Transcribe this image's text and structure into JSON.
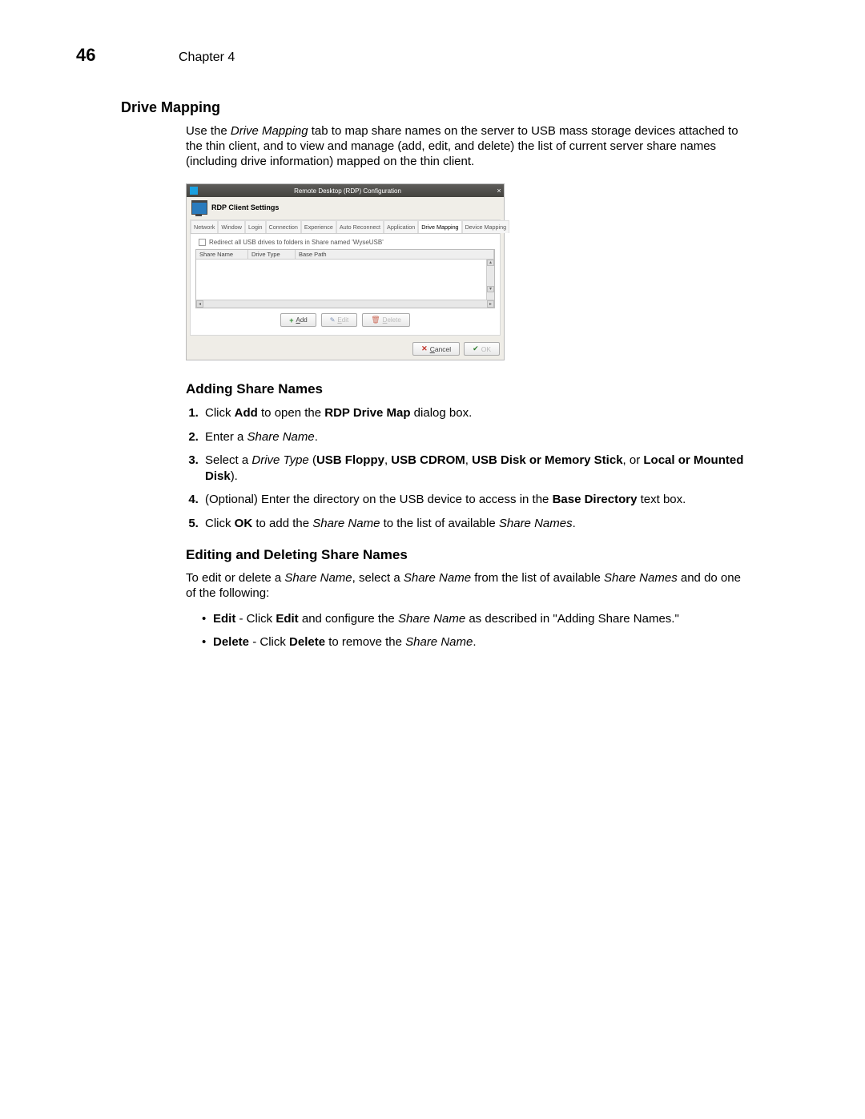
{
  "header": {
    "page_number": "46",
    "chapter": "Chapter 4"
  },
  "s1": {
    "title": "Drive Mapping",
    "para1_a": "Use the ",
    "para1_b": "Drive Mapping",
    "para1_c": " tab to map share names on the server to USB mass storage devices attached to the thin client, and to view and manage (add, edit, and delete) the list of current server share names (including drive information) mapped on the thin client."
  },
  "dlg": {
    "title": "Remote Desktop (RDP) Configuration",
    "subtitle": "RDP Client Settings",
    "tabs": [
      "Network",
      "Window",
      "Login",
      "Connection",
      "Experience",
      "Auto Reconnect",
      "Application",
      "Drive Mapping",
      "Device Mapping"
    ],
    "active_tab": "Drive Mapping",
    "checkbox": "Redirect all USB drives to folders in Share named 'WyseUSB'",
    "cols": [
      "Share Name",
      "Drive Type",
      "Base Path"
    ],
    "btn_add": "Add",
    "btn_edit": "Edit",
    "btn_delete": "Delete",
    "btn_cancel": "Cancel",
    "btn_ok": "OK"
  },
  "s2": {
    "title": "Adding Share Names",
    "i1a": "Click ",
    "i1b": "Add",
    "i1c": " to open the ",
    "i1d": "RDP Drive Map",
    "i1e": " dialog box.",
    "i2a": "Enter a ",
    "i2b": "Share Name",
    "i2c": ".",
    "i3a": "Select a ",
    "i3b": "Drive Type",
    "i3c": " (",
    "i3d": "USB Floppy",
    "i3e": ", ",
    "i3f": "USB CDROM",
    "i3g": ", ",
    "i3h": "USB Disk or Memory Stick",
    "i3i": ", or ",
    "i3j": "Local or Mounted Disk",
    "i3k": ").",
    "i4a": "(Optional) Enter the directory on the USB device to access in the ",
    "i4b": "Base Directory",
    "i4c": " text box.",
    "i5a": "Click ",
    "i5b": "OK",
    "i5c": " to add the ",
    "i5d": "Share Name",
    "i5e": " to the list of available ",
    "i5f": "Share Names",
    "i5g": "."
  },
  "s3": {
    "title": "Editing and Deleting Share Names",
    "p1a": "To edit or delete a ",
    "p1b": "Share Name",
    "p1c": ", select a ",
    "p1d": "Share Name",
    "p1e": " from the list of available ",
    "p1f": "Share Names",
    "p1g": " and do one of the following:",
    "b1a": "Edit",
    "b1b": " - Click ",
    "b1c": "Edit",
    "b1d": " and configure the ",
    "b1e": "Share Name",
    "b1f": " as described in \"Adding Share Names.\"",
    "b2a": "Delete",
    "b2b": " - Click ",
    "b2c": "Delete",
    "b2d": " to remove the ",
    "b2e": "Share Name",
    "b2f": "."
  }
}
